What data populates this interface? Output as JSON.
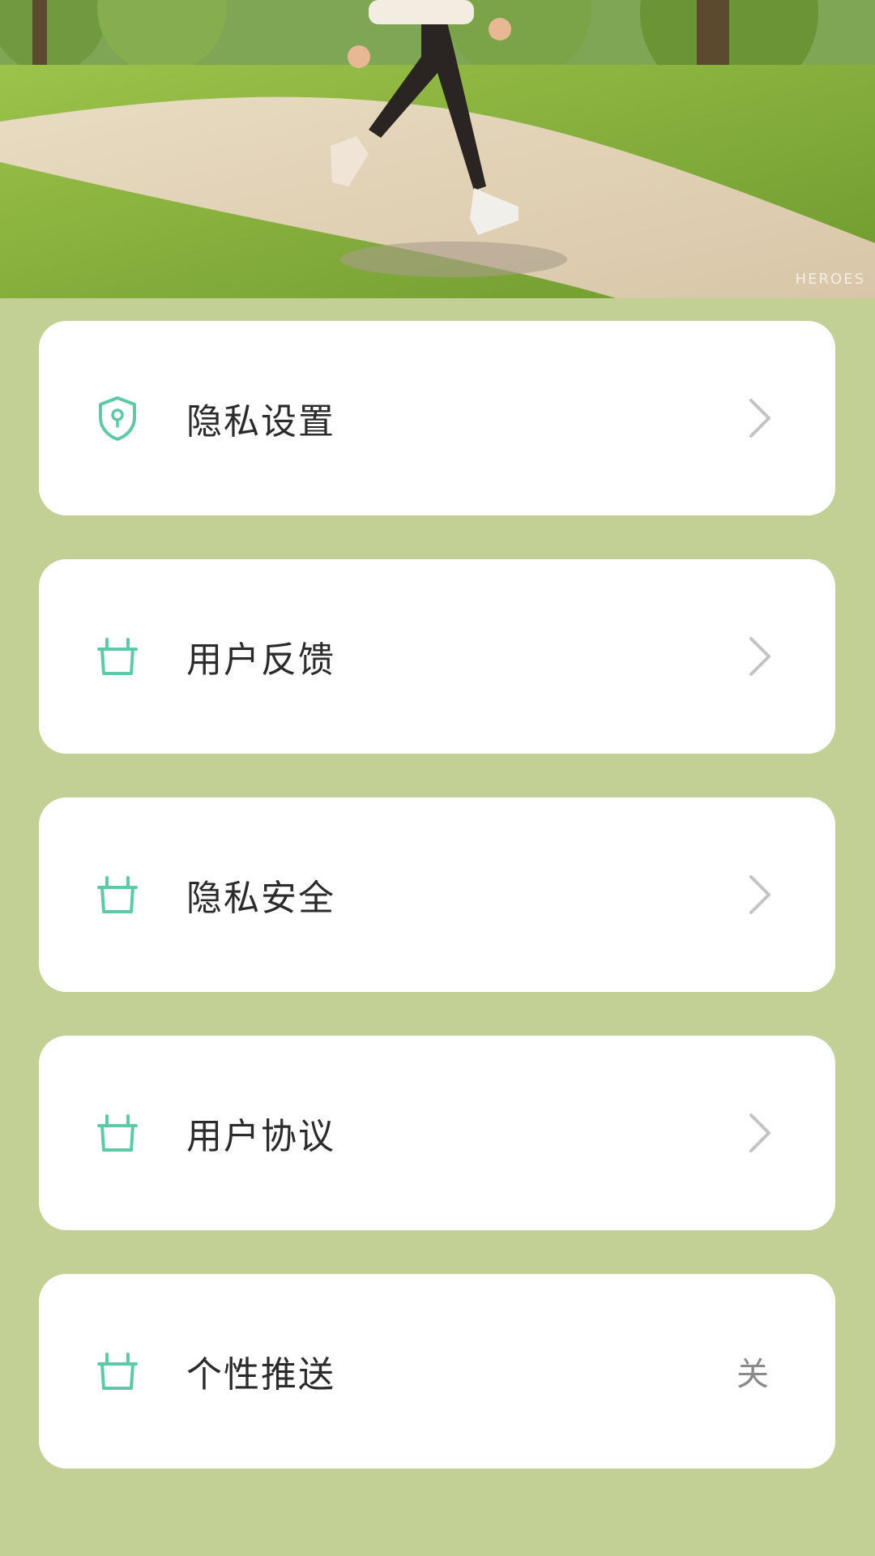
{
  "hero": {
    "image_name": "park-runner-illustration",
    "watermark": "HEROES"
  },
  "menu": {
    "items": [
      {
        "label": "隐私设置",
        "icon": "shield-location-icon",
        "trailing": "chevron-right-icon"
      },
      {
        "label": "用户反馈",
        "icon": "basket-icon",
        "trailing": "chevron-right-icon"
      },
      {
        "label": "隐私安全",
        "icon": "basket-icon",
        "trailing": "chevron-right-icon"
      },
      {
        "label": "用户协议",
        "icon": "basket-icon",
        "trailing": "chevron-right-icon"
      },
      {
        "label": "个性推送",
        "icon": "basket-icon",
        "trailing_value": "关"
      }
    ]
  },
  "colors": {
    "background": "#c2d095",
    "card": "#ffffff",
    "icon_accent": "#5ccaa8",
    "text": "#2b2b2b",
    "chevron": "#c4c4c4"
  }
}
